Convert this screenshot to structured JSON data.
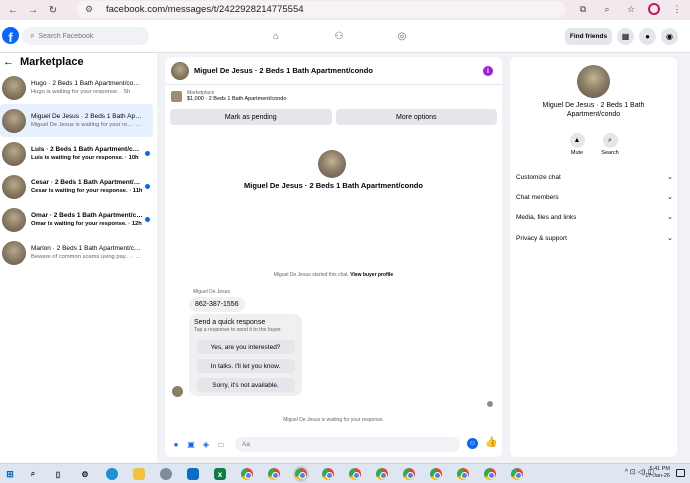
{
  "browser": {
    "url": "facebook.com/messages/t/2422928214775554"
  },
  "fb": {
    "search_placeholder": "Search Facebook",
    "find_friends": "Find friends"
  },
  "left": {
    "title": "Marketplace",
    "conversations": [
      {
        "name": "Hugo · 2 Beds 1 Bath Apartment/condo",
        "snippet": "Hugo is waiting for your response. · 5h"
      },
      {
        "name": "Miguel De Jesus · 2 Beds 1 Bath Apartment/condo",
        "snippet": "Miguel De Jesus is waiting for your re... · 8h"
      },
      {
        "name": "Luis · 2 Beds 1 Bath Apartment/condo",
        "snippet": "Luis is waiting for your response. · 10h"
      },
      {
        "name": "Cesar · 2 Beds 1 Bath Apartment/condo",
        "snippet": "Cesar is waiting for your response. · 11h"
      },
      {
        "name": "Omar · 2 Beds 1 Bath Apartment/condo",
        "snippet": "Omar is waiting for your response. · 12h"
      },
      {
        "name": "Marlon · 2 Beds 1 Bath Apartment/condo",
        "snippet": "Beware of common scams using pay... · 23h"
      }
    ]
  },
  "chat": {
    "header_name": "Miguel De Jesus · 2 Beds 1 Bath Apartment/condo",
    "listing_label": "Marketplace",
    "listing_detail": "$1,000 · 2 Beds 1 Bath Apartment/condo",
    "mark_pending": "Mark as pending",
    "more_options": "More options",
    "center_title": "Miguel De Jesus · 2 Beds 1 Bath Apartment/condo",
    "started_text": "Miguel De Jesus started this chat.",
    "view_profile": "View buyer profile",
    "sender": "Miguel De Jesus",
    "phone": "862-387-1556",
    "quick_title": "Send a quick response",
    "quick_sub": "Tap a response to send it to the buyer.",
    "quick_replies": [
      "Yes, are you interested?",
      "In talks. I'll let you know.",
      "Sorry, it's not available."
    ],
    "waiting": "Miguel De Jesus is waiting for your response.",
    "composer_placeholder": "Aa"
  },
  "right": {
    "name": "Miguel De Jesus · 2 Beds 1 Bath Apartment/condo",
    "mute": "Mute",
    "search": "Search",
    "sections": [
      "Customize chat",
      "Chat members",
      "Media, files and links",
      "Privacy & support"
    ]
  },
  "taskbar": {
    "time": "5:41 PM",
    "date": "17-Jan-26"
  },
  "colors": {
    "accent": "#0866ff",
    "unread_dot": "#0866ff",
    "info_icon": "#9b20d9"
  }
}
